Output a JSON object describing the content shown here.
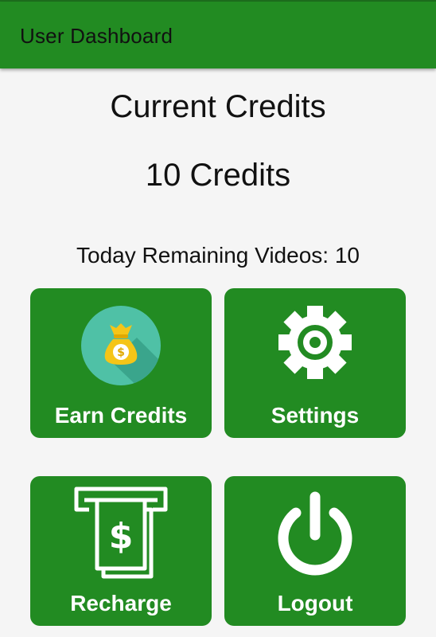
{
  "app_bar": {
    "title": "User Dashboard",
    "color": "#228b22"
  },
  "credits": {
    "heading": "Current Credits",
    "value": "10 Credits"
  },
  "remaining_videos": "Today Remaining Videos: 10",
  "tiles": {
    "earn": {
      "label": "Earn Credits",
      "icon": "money-bag-icon"
    },
    "settings": {
      "label": "Settings",
      "icon": "gear-icon"
    },
    "recharge": {
      "label": "Recharge",
      "icon": "atm-cash-icon"
    },
    "logout": {
      "label": "Logout",
      "icon": "power-icon"
    }
  },
  "colors": {
    "tile": "#228b22",
    "icon_badge": "#4fc1a6",
    "bag": "#f5c518"
  }
}
